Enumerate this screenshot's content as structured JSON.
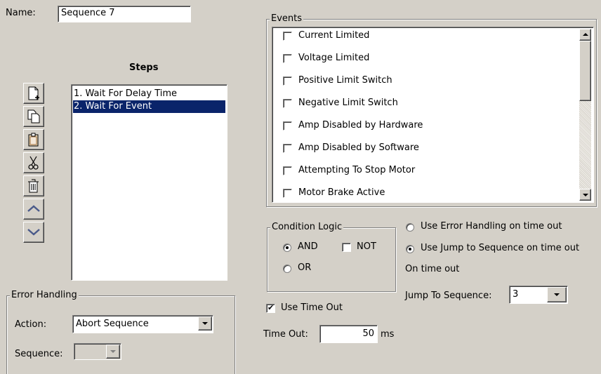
{
  "name": {
    "label": "Name:",
    "value": "Sequence 7"
  },
  "steps": {
    "title": "Steps",
    "items": [
      "1. Wait For Delay Time",
      "2. Wait For Event"
    ],
    "selected_index": 1,
    "toolbar": [
      {
        "name": "new-step-button",
        "icon": "new-document-icon"
      },
      {
        "name": "copy-step-button",
        "icon": "copy-icon"
      },
      {
        "name": "paste-step-button",
        "icon": "clipboard-icon"
      },
      {
        "name": "cut-step-button",
        "icon": "scissors-icon"
      },
      {
        "name": "delete-step-button",
        "icon": "trash-icon"
      },
      {
        "name": "move-up-button",
        "icon": "chevron-up-icon"
      },
      {
        "name": "move-down-button",
        "icon": "chevron-down-icon"
      }
    ]
  },
  "error_handling": {
    "title": "Error Handling",
    "action_label": "Action:",
    "action_value": "Abort Sequence",
    "sequence_label": "Sequence:",
    "sequence_value": ""
  },
  "events": {
    "title": "Events",
    "items": [
      {
        "label": "Current Limited",
        "checked": false
      },
      {
        "label": "Voltage Limited",
        "checked": false
      },
      {
        "label": "Positive Limit Switch",
        "checked": false
      },
      {
        "label": "Negative Limit Switch",
        "checked": false
      },
      {
        "label": "Amp Disabled by Hardware",
        "checked": false
      },
      {
        "label": "Amp Disabled by Software",
        "checked": false
      },
      {
        "label": "Attempting To Stop Motor",
        "checked": false
      },
      {
        "label": "Motor Brake Active",
        "checked": false
      }
    ]
  },
  "condition_logic": {
    "title": "Condition Logic",
    "and_label": "AND",
    "or_label": "OR",
    "not_label": "NOT",
    "selected": "AND",
    "not_checked": false
  },
  "timeout_handling": {
    "error_option_label": "Use Error Handling on time out",
    "jump_option_label": "Use Jump to Sequence on time out",
    "selected": "jump",
    "on_time_out_label": "On time out",
    "jump_label": "Jump To Sequence:",
    "jump_value": "3"
  },
  "timeout": {
    "use_label": "Use Time Out",
    "use_checked": true,
    "label": "Time Out:",
    "value": "50",
    "unit": "ms"
  },
  "colors": {
    "window_bg": "#d4d0c8",
    "selection_bg": "#0a246a",
    "selection_fg": "#ffffff"
  }
}
